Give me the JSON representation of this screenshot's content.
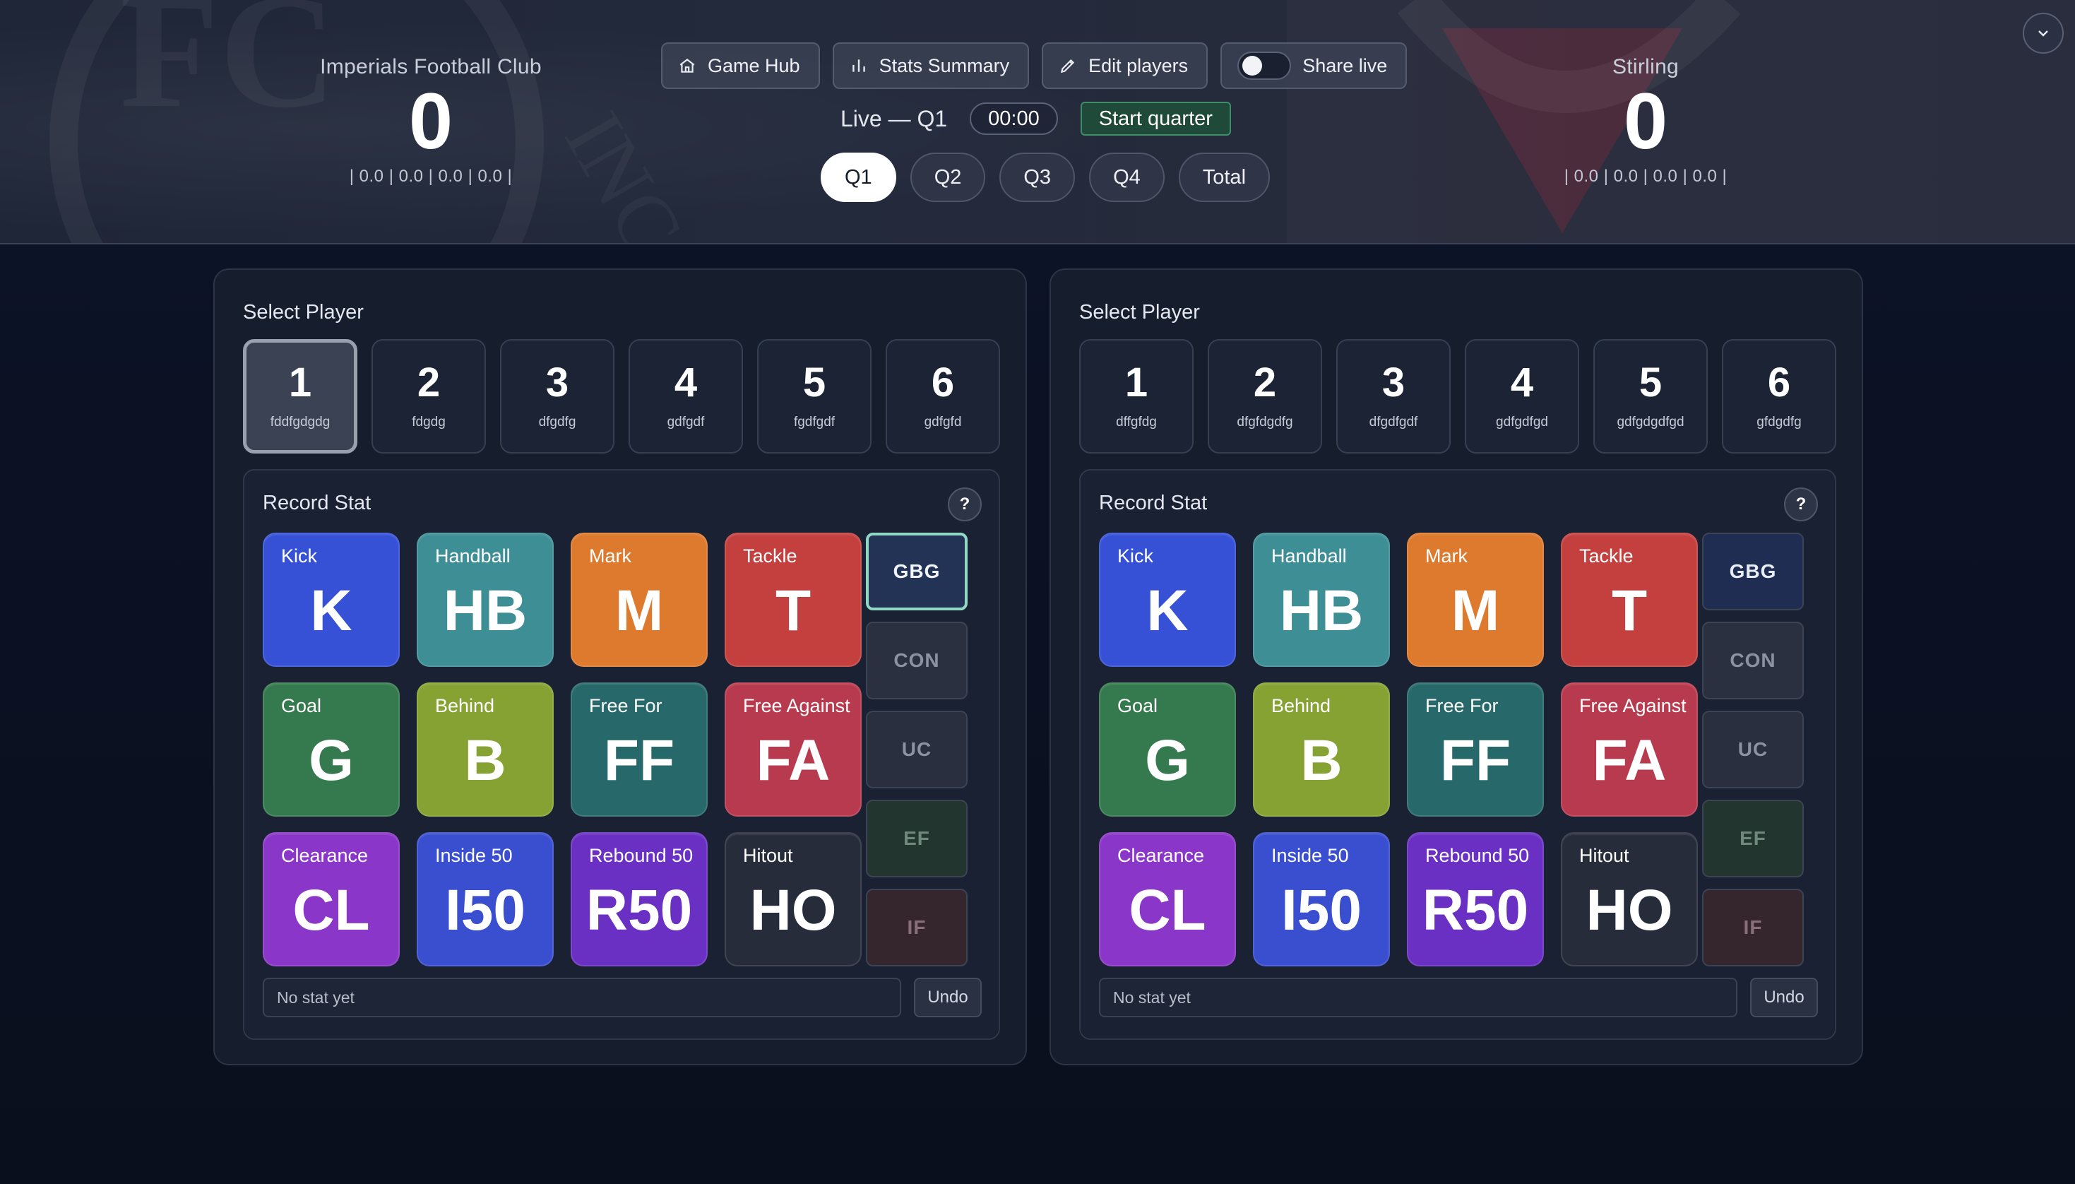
{
  "header": {
    "home_team": {
      "name": "Imperials Football Club",
      "score": "0",
      "quarters": "| 0.0 | 0.0 | 0.0 | 0.0 |"
    },
    "away_team": {
      "name": "Stirling",
      "score": "0",
      "quarters": "| 0.0 | 0.0 | 0.0 | 0.0 |"
    },
    "toolbar": {
      "game_hub": "Game Hub",
      "stats_summary": "Stats Summary",
      "edit_players": "Edit players",
      "share_live": "Share live",
      "share_live_on": false
    },
    "status": {
      "live_label": "Live — Q1",
      "timer": "00:00",
      "start_label": "Start quarter"
    },
    "quarter_tabs": [
      "Q1",
      "Q2",
      "Q3",
      "Q4",
      "Total"
    ],
    "active_quarter": "Q1"
  },
  "left_panel": {
    "select_title": "Select Player",
    "players": [
      {
        "number": "1",
        "name": "fddfgdgdg"
      },
      {
        "number": "2",
        "name": "fdgdg"
      },
      {
        "number": "3",
        "name": "dfgdfg"
      },
      {
        "number": "4",
        "name": "gdfgdf"
      },
      {
        "number": "5",
        "name": "fgdfgdf"
      },
      {
        "number": "6",
        "name": "gdfgfd"
      }
    ],
    "record_title": "Record Stat",
    "help": "?",
    "last_stat": "No stat yet",
    "undo": "Undo"
  },
  "right_panel": {
    "select_title": "Select Player",
    "players": [
      {
        "number": "1",
        "name": "dffgfdg"
      },
      {
        "number": "2",
        "name": "dfgfdgdfg"
      },
      {
        "number": "3",
        "name": "dfgdfgdf"
      },
      {
        "number": "4",
        "name": "gdfgdfgd"
      },
      {
        "number": "5",
        "name": "gdfgdgdfgd"
      },
      {
        "number": "6",
        "name": "gfdgdfg"
      }
    ],
    "record_title": "Record Stat",
    "help": "?",
    "last_stat": "No stat yet",
    "undo": "Undo"
  },
  "stats": [
    {
      "label": "Kick",
      "abbr": "K",
      "color": "#3651d6"
    },
    {
      "label": "Handball",
      "abbr": "HB",
      "color": "#3e8e96"
    },
    {
      "label": "Mark",
      "abbr": "M",
      "color": "#dd7a2e"
    },
    {
      "label": "Tackle",
      "abbr": "T",
      "color": "#c4403e"
    },
    {
      "label": "Goal",
      "abbr": "G",
      "color": "#357a4e"
    },
    {
      "label": "Behind",
      "abbr": "B",
      "color": "#86a232"
    },
    {
      "label": "Free For",
      "abbr": "FF",
      "color": "#27696a"
    },
    {
      "label": "Free Against",
      "abbr": "FA",
      "color": "#b83a4e"
    },
    {
      "label": "Clearance",
      "abbr": "CL",
      "color": "#8a36c8"
    },
    {
      "label": "Inside 50",
      "abbr": "I50",
      "color": "#3a4ed0"
    },
    {
      "label": "Rebound 50",
      "abbr": "R50",
      "color": "#6a30c4"
    },
    {
      "label": "Hitout",
      "abbr": "HO",
      "color": "#262c3a"
    }
  ],
  "side_stats": [
    {
      "label": "GBG",
      "bg": "#1f2d52",
      "fg": "#e9edf6"
    },
    {
      "label": "CON",
      "bg": "#2b3040",
      "fg": "#8c92a1"
    },
    {
      "label": "UC",
      "bg": "#2a2f3f",
      "fg": "#8c92a1"
    },
    {
      "label": "EF",
      "bg": "#22362f",
      "fg": "#6f8a7c"
    },
    {
      "label": "IF",
      "bg": "#35262d",
      "fg": "#8a6f78"
    }
  ],
  "left_side_highlight": "GBG"
}
